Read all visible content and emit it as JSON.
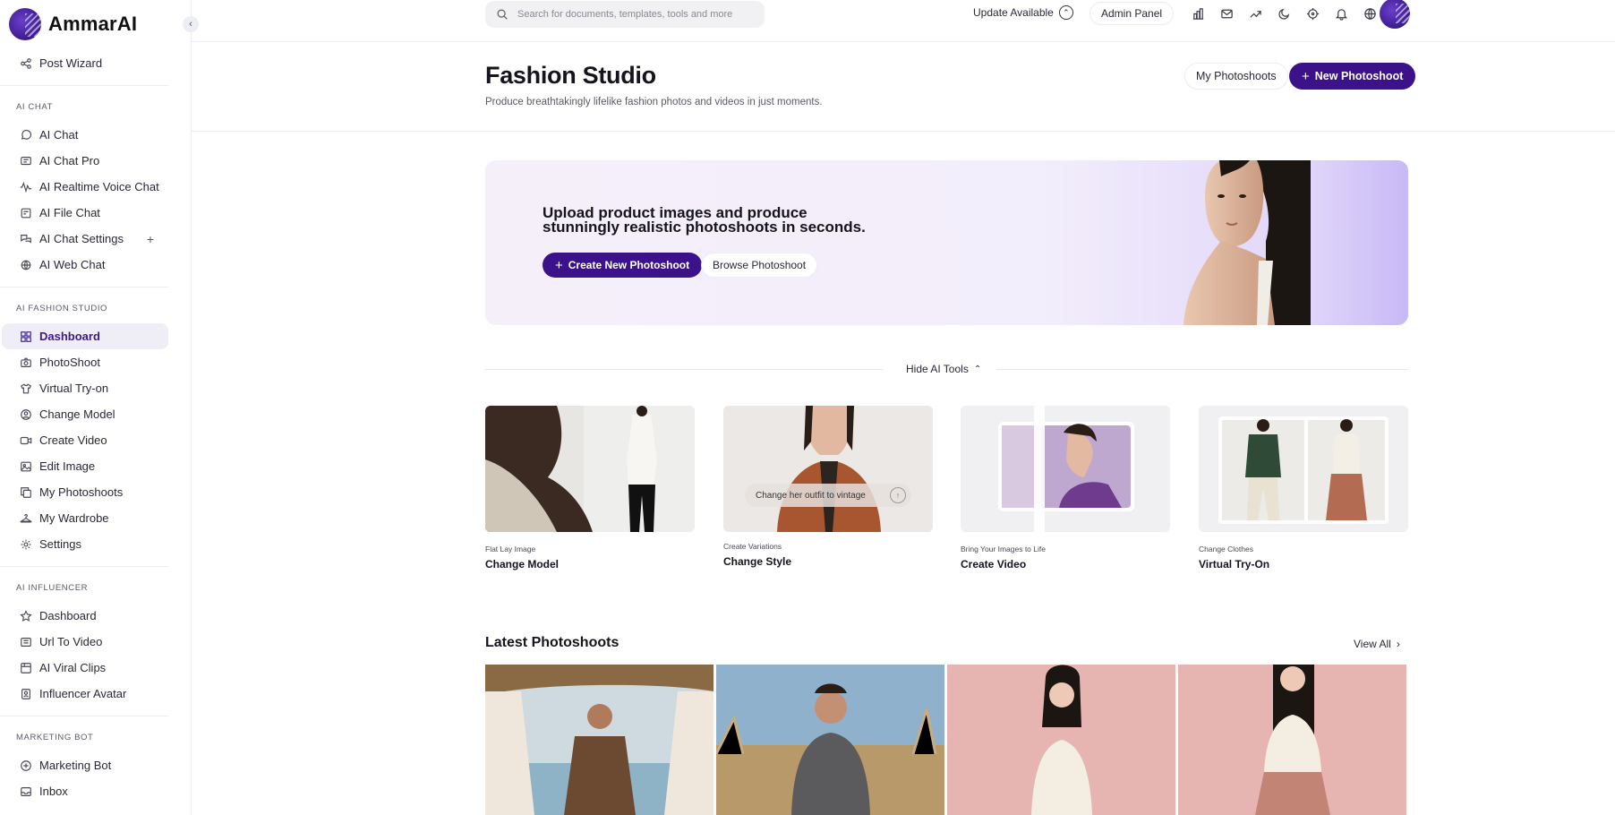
{
  "brand": {
    "name": "AmmarAI"
  },
  "sidebar": {
    "top_item": {
      "label": "Post Wizard",
      "icon": "share-nodes-icon"
    },
    "sections": [
      {
        "heading": "AI CHAT",
        "items": [
          {
            "label": "AI Chat",
            "icon": "chat-bubble-icon"
          },
          {
            "label": "AI Chat Pro",
            "icon": "chat-pro-icon"
          },
          {
            "label": "AI Realtime Voice Chat",
            "icon": "voice-wave-icon"
          },
          {
            "label": "AI File Chat",
            "icon": "file-icon"
          },
          {
            "label": "AI Chat Settings",
            "icon": "chat-settings-icon"
          },
          {
            "label": "AI Web Chat",
            "icon": "globe-chat-icon"
          }
        ]
      },
      {
        "heading": "AI FASHION STUDIO",
        "items": [
          {
            "label": "Dashboard",
            "icon": "grid-icon",
            "active": true
          },
          {
            "label": "PhotoShoot",
            "icon": "camera-icon"
          },
          {
            "label": "Virtual Try-on",
            "icon": "shirt-icon"
          },
          {
            "label": "Change Model",
            "icon": "user-circle-icon"
          },
          {
            "label": "Create Video",
            "icon": "video-icon"
          },
          {
            "label": "Edit Image",
            "icon": "image-edit-icon"
          },
          {
            "label": "My Photoshoots",
            "icon": "copy-icon"
          },
          {
            "label": "My Wardrobe",
            "icon": "hanger-icon"
          },
          {
            "label": "Settings",
            "icon": "gear-icon"
          }
        ]
      },
      {
        "heading": "AI INFLUENCER",
        "items": [
          {
            "label": "Dashboard",
            "icon": "star-icon"
          },
          {
            "label": "Url To Video",
            "icon": "link-video-icon"
          },
          {
            "label": "AI Viral Clips",
            "icon": "clips-icon"
          },
          {
            "label": "Influencer Avatar",
            "icon": "avatar-icon"
          }
        ]
      },
      {
        "heading": "MARKETING BOT",
        "items": [
          {
            "label": "Marketing Bot",
            "icon": "bot-icon"
          },
          {
            "label": "Inbox",
            "icon": "inbox-icon"
          }
        ]
      }
    ]
  },
  "topbar": {
    "search_placeholder": "Search for documents, templates, tools and more",
    "update_label": "Update Available",
    "admin_label": "Admin Panel",
    "icons": [
      "affiliate-icon",
      "mail-icon",
      "trending-icon",
      "moon-icon",
      "crosshair-icon",
      "bell-icon",
      "globe-icon"
    ]
  },
  "header": {
    "title": "Fashion Studio",
    "subtitle": "Produce breathtakingly lifelike fashion photos and videos in just moments.",
    "my_photoshoots_label": "My Photoshoots",
    "new_photoshoot_label": "New Photoshoot"
  },
  "hero": {
    "headline": "Upload product images and produce stunningly realistic photoshoots in seconds.",
    "create_label": "Create New Photoshoot",
    "browse_label": "Browse Photoshoot"
  },
  "tools": {
    "toggle_label": "Hide AI Tools",
    "cards": [
      {
        "caption": "Flat Lay Image",
        "title": "Change Model"
      },
      {
        "caption": "Create Variations",
        "title": "Change Style",
        "prompt": "Change her outfit to vintage"
      },
      {
        "caption": "Bring Your Images to Life",
        "title": "Create Video"
      },
      {
        "caption": "Change Clothes",
        "title": "Virtual Try-On"
      }
    ]
  },
  "latest": {
    "title": "Latest Photoshoots",
    "view_all_label": "View All"
  },
  "colors": {
    "accent": "#3b1289",
    "active_bg": "#efeef6"
  }
}
